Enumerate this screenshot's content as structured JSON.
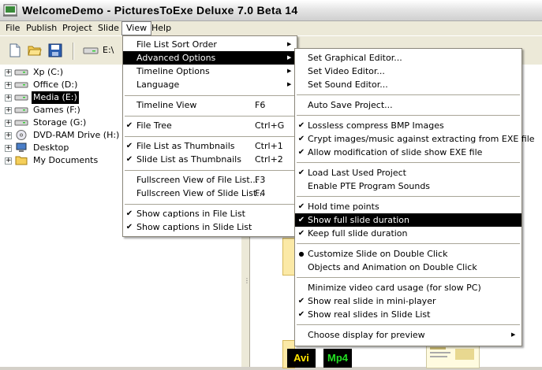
{
  "window": {
    "title": "WelcomeDemo - PicturesToExe Deluxe 7.0 Beta 14"
  },
  "menubar": [
    {
      "label": "File"
    },
    {
      "label": "Publish"
    },
    {
      "label": "Project"
    },
    {
      "label": "Slide"
    },
    {
      "label": "View"
    },
    {
      "label": "Help"
    }
  ],
  "toolbar": {
    "drive_label": "E:\\"
  },
  "tree": [
    {
      "label": "Xp (C:)",
      "icon": "hard-drive-icon"
    },
    {
      "label": "Office (D:)",
      "icon": "hard-drive-icon"
    },
    {
      "label": "Media (E:)",
      "icon": "hard-drive-icon",
      "selected": true
    },
    {
      "label": "Games (F:)",
      "icon": "hard-drive-icon"
    },
    {
      "label": "Storage (G:)",
      "icon": "hard-drive-icon"
    },
    {
      "label": "DVD-RAM Drive (H:)",
      "icon": "dvd-drive-icon"
    },
    {
      "label": "Desktop",
      "icon": "desktop-icon"
    },
    {
      "label": "My Documents",
      "icon": "folder-icon"
    }
  ],
  "thumbs": {
    "avi_label": "Avi",
    "mp4_label": "Mp4"
  },
  "view_menu": {
    "items": [
      {
        "label": "File List Sort Order",
        "submenu": true
      },
      {
        "label": "Advanced Options",
        "submenu": true,
        "highlighted": true
      },
      {
        "label": "Timeline Options",
        "submenu": true
      },
      {
        "label": "Language",
        "submenu": true
      },
      {
        "separator": true
      },
      {
        "label": "Timeline View",
        "shortcut": "F6"
      },
      {
        "separator": true
      },
      {
        "label": "File Tree",
        "shortcut": "Ctrl+G",
        "checked": true
      },
      {
        "separator": true
      },
      {
        "label": "File List as Thumbnails",
        "shortcut": "Ctrl+1",
        "checked": true
      },
      {
        "label": "Slide List as Thumbnails",
        "shortcut": "Ctrl+2",
        "checked": true
      },
      {
        "separator": true
      },
      {
        "label": "Fullscreen View of File List...",
        "shortcut": "F3"
      },
      {
        "label": "Fullscreen View of Slide List...",
        "shortcut": "F4"
      },
      {
        "separator": true
      },
      {
        "label": "Show captions in File List",
        "checked": true
      },
      {
        "label": "Show captions in Slide List",
        "checked": true
      }
    ]
  },
  "advanced_menu": {
    "items": [
      {
        "label": "Set Graphical Editor..."
      },
      {
        "label": "Set Video Editor..."
      },
      {
        "label": "Set Sound Editor..."
      },
      {
        "separator": true
      },
      {
        "label": "Auto Save Project..."
      },
      {
        "separator": true
      },
      {
        "label": "Lossless compress BMP Images",
        "checked": true
      },
      {
        "label": "Crypt images/music against extracting from EXE file",
        "checked": true
      },
      {
        "label": "Allow modification of slide show EXE file",
        "checked": true
      },
      {
        "separator": true
      },
      {
        "label": "Load Last Used Project",
        "checked": true
      },
      {
        "label": "Enable PTE Program Sounds"
      },
      {
        "separator": true
      },
      {
        "label": "Hold time points",
        "checked": true
      },
      {
        "label": "Show full slide duration",
        "checked": true,
        "highlighted": true
      },
      {
        "label": "Keep full slide duration",
        "checked": true
      },
      {
        "separator": true
      },
      {
        "label": "Customize Slide on Double Click",
        "radio": true
      },
      {
        "label": "Objects and Animation on Double Click"
      },
      {
        "separator": true
      },
      {
        "label": "Minimize video card usage (for slow PC)"
      },
      {
        "label": "Show real slide in mini-player",
        "checked": true
      },
      {
        "label": "Show real slides in Slide List",
        "checked": true
      },
      {
        "separator": true
      },
      {
        "label": "Choose display for preview",
        "submenu": true
      }
    ]
  },
  "colors": {
    "highlight": "#000000",
    "menu_bg": "#ffffff",
    "chrome": "#ece9d8"
  }
}
